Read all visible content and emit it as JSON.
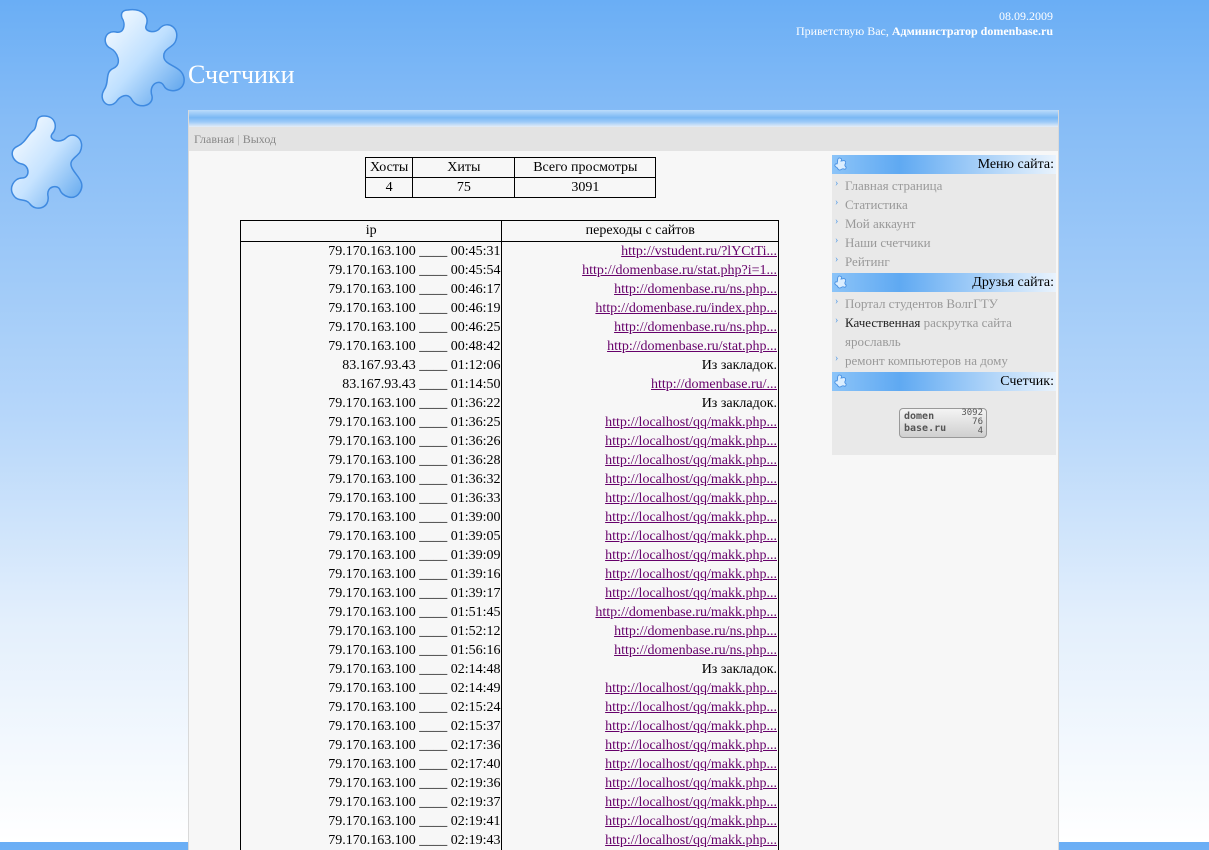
{
  "header": {
    "date": "08.09.2009",
    "greeting": "Приветствую Вас,",
    "user": "Администратор domenbase.ru",
    "title": "Счетчики"
  },
  "nav": {
    "home": "Главная",
    "separator": "|",
    "logout": "Выход"
  },
  "summary": {
    "headers": [
      "Хосты",
      "Хиты",
      "Всего просмотры"
    ],
    "values": [
      "4",
      "75",
      "3091"
    ]
  },
  "visits": {
    "headers": [
      "ip",
      "переходы с сайтов"
    ],
    "rows": [
      {
        "ip": "79.170.163.100 ____ 00:45:31",
        "src": "http://vstudent.ru/?lYCtTi...",
        "link": true
      },
      {
        "ip": "79.170.163.100 ____ 00:45:54",
        "src": "http://domenbase.ru/stat.php?i=1...",
        "link": true
      },
      {
        "ip": "79.170.163.100 ____ 00:46:17",
        "src": "http://domenbase.ru/ns.php...",
        "link": true
      },
      {
        "ip": "79.170.163.100 ____ 00:46:19",
        "src": "http://domenbase.ru/index.php...",
        "link": true
      },
      {
        "ip": "79.170.163.100 ____ 00:46:25",
        "src": "http://domenbase.ru/ns.php...",
        "link": true
      },
      {
        "ip": "79.170.163.100 ____ 00:48:42",
        "src": "http://domenbase.ru/stat.php...",
        "link": true
      },
      {
        "ip": "83.167.93.43 ____ 01:12:06",
        "src": "Из закладок.",
        "link": false
      },
      {
        "ip": "83.167.93.43 ____ 01:14:50",
        "src": "http://domenbase.ru/...",
        "link": true
      },
      {
        "ip": "79.170.163.100 ____ 01:36:22",
        "src": "Из закладок.",
        "link": false
      },
      {
        "ip": "79.170.163.100 ____ 01:36:25",
        "src": "http://localhost/qq/makk.php...",
        "link": true
      },
      {
        "ip": "79.170.163.100 ____ 01:36:26",
        "src": "http://localhost/qq/makk.php...",
        "link": true
      },
      {
        "ip": "79.170.163.100 ____ 01:36:28",
        "src": "http://localhost/qq/makk.php...",
        "link": true
      },
      {
        "ip": "79.170.163.100 ____ 01:36:32",
        "src": "http://localhost/qq/makk.php...",
        "link": true
      },
      {
        "ip": "79.170.163.100 ____ 01:36:33",
        "src": "http://localhost/qq/makk.php...",
        "link": true
      },
      {
        "ip": "79.170.163.100 ____ 01:39:00",
        "src": "http://localhost/qq/makk.php...",
        "link": true
      },
      {
        "ip": "79.170.163.100 ____ 01:39:05",
        "src": "http://localhost/qq/makk.php...",
        "link": true
      },
      {
        "ip": "79.170.163.100 ____ 01:39:09",
        "src": "http://localhost/qq/makk.php...",
        "link": true
      },
      {
        "ip": "79.170.163.100 ____ 01:39:16",
        "src": "http://localhost/qq/makk.php...",
        "link": true
      },
      {
        "ip": "79.170.163.100 ____ 01:39:17",
        "src": "http://localhost/qq/makk.php...",
        "link": true
      },
      {
        "ip": "79.170.163.100 ____ 01:51:45",
        "src": "http://domenbase.ru/makk.php...",
        "link": true
      },
      {
        "ip": "79.170.163.100 ____ 01:52:12",
        "src": "http://domenbase.ru/ns.php...",
        "link": true
      },
      {
        "ip": "79.170.163.100 ____ 01:56:16",
        "src": "http://domenbase.ru/ns.php...",
        "link": true
      },
      {
        "ip": "79.170.163.100 ____ 02:14:48",
        "src": "Из закладок.",
        "link": false
      },
      {
        "ip": "79.170.163.100 ____ 02:14:49",
        "src": "http://localhost/qq/makk.php...",
        "link": true
      },
      {
        "ip": "79.170.163.100 ____ 02:15:24",
        "src": "http://localhost/qq/makk.php...",
        "link": true
      },
      {
        "ip": "79.170.163.100 ____ 02:15:37",
        "src": "http://localhost/qq/makk.php...",
        "link": true
      },
      {
        "ip": "79.170.163.100 ____ 02:17:36",
        "src": "http://localhost/qq/makk.php...",
        "link": true
      },
      {
        "ip": "79.170.163.100 ____ 02:17:40",
        "src": "http://localhost/qq/makk.php...",
        "link": true
      },
      {
        "ip": "79.170.163.100 ____ 02:19:36",
        "src": "http://localhost/qq/makk.php...",
        "link": true
      },
      {
        "ip": "79.170.163.100 ____ 02:19:37",
        "src": "http://localhost/qq/makk.php...",
        "link": true
      },
      {
        "ip": "79.170.163.100 ____ 02:19:41",
        "src": "http://localhost/qq/makk.php...",
        "link": true
      },
      {
        "ip": "79.170.163.100 ____ 02:19:43",
        "src": "http://localhost/qq/makk.php...",
        "link": true
      }
    ]
  },
  "sidebar": {
    "menu": {
      "title": "Меню сайта:",
      "items": [
        "Главная страница",
        "Статистика",
        "Мой аккаунт",
        "Наши счетчики",
        "Рейтинг"
      ]
    },
    "friends": {
      "title": "Друзья сайта:",
      "item1": "Портал студентов ВолгГТУ",
      "item2_dark": "Качественная",
      "item2_rest": "раскрутка сайта ярославль",
      "item3": "ремонт компьютеров на дому"
    },
    "counter": {
      "title": "Счетчик:",
      "badge_line1": "domen",
      "badge_line2": "base.ru",
      "badge_numbers": [
        "3092",
        "76",
        "4"
      ]
    }
  },
  "colors": {
    "link": "#66006a",
    "accent": "#5fa9f2"
  },
  "icons": [
    "puzzle-piece-icon",
    "arrow-bullet-icon"
  ]
}
